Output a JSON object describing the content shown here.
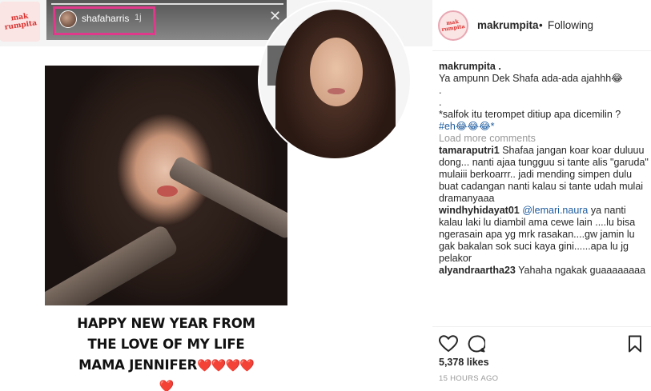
{
  "watermark": {
    "text_line1": "mak",
    "text_line2": "rumpita"
  },
  "story": {
    "username": "shafaharris",
    "time": "1j",
    "close_glyph": "✕"
  },
  "caption": {
    "line1": "HAPPY NEW YEAR FROM",
    "line2": "THE LOVE OF MY LIFE",
    "line3": "MAMA JENNIFER",
    "hearts_inline": "❤️❤️❤️❤️",
    "heart_last": "❤️"
  },
  "post_header": {
    "username": "makrumpita",
    "separator": "•",
    "follow_status": "Following"
  },
  "post_caption": {
    "username": "makrumpita .",
    "line1": "Ya ampunn Dek Shafa ada-ada ajahhh😂",
    "dot1": ".",
    "dot2": ".",
    "line2": "*salfok itu terompet ditiup apa dicemilin ?",
    "hashtag": "#eh😂😂😂*"
  },
  "load_more": "Load more comments",
  "comments": [
    {
      "user": "tamaraputri1",
      "text": "Shafaa jangan koar koar duluuu dong... nanti ajaa tungguu si tante alis \"garuda\" mulaiii berkoarrr.. jadi mending simpen dulu buat cadangan nanti kalau si tante udah mulai dramanyaaa"
    },
    {
      "user": "windhyhidayat01",
      "mention": "@lemari.naura",
      "text": "ya nanti kalau laki lu diambil ama cewe lain ....lu bisa ngerasain apa yg mrk rasakan....gw jamin lu gak bakalan sok suci kaya gini......apa lu jg pelakor"
    },
    {
      "user": "alyandraartha23",
      "text": "Yahaha ngakak guaaaaaaaa"
    }
  ],
  "actions": {
    "like_icon": "heart-outline",
    "comment_icon": "speech-bubble-outline",
    "save_icon": "bookmark-outline"
  },
  "likes": "5,378 likes",
  "timestamp": "15 HOURS AGO"
}
